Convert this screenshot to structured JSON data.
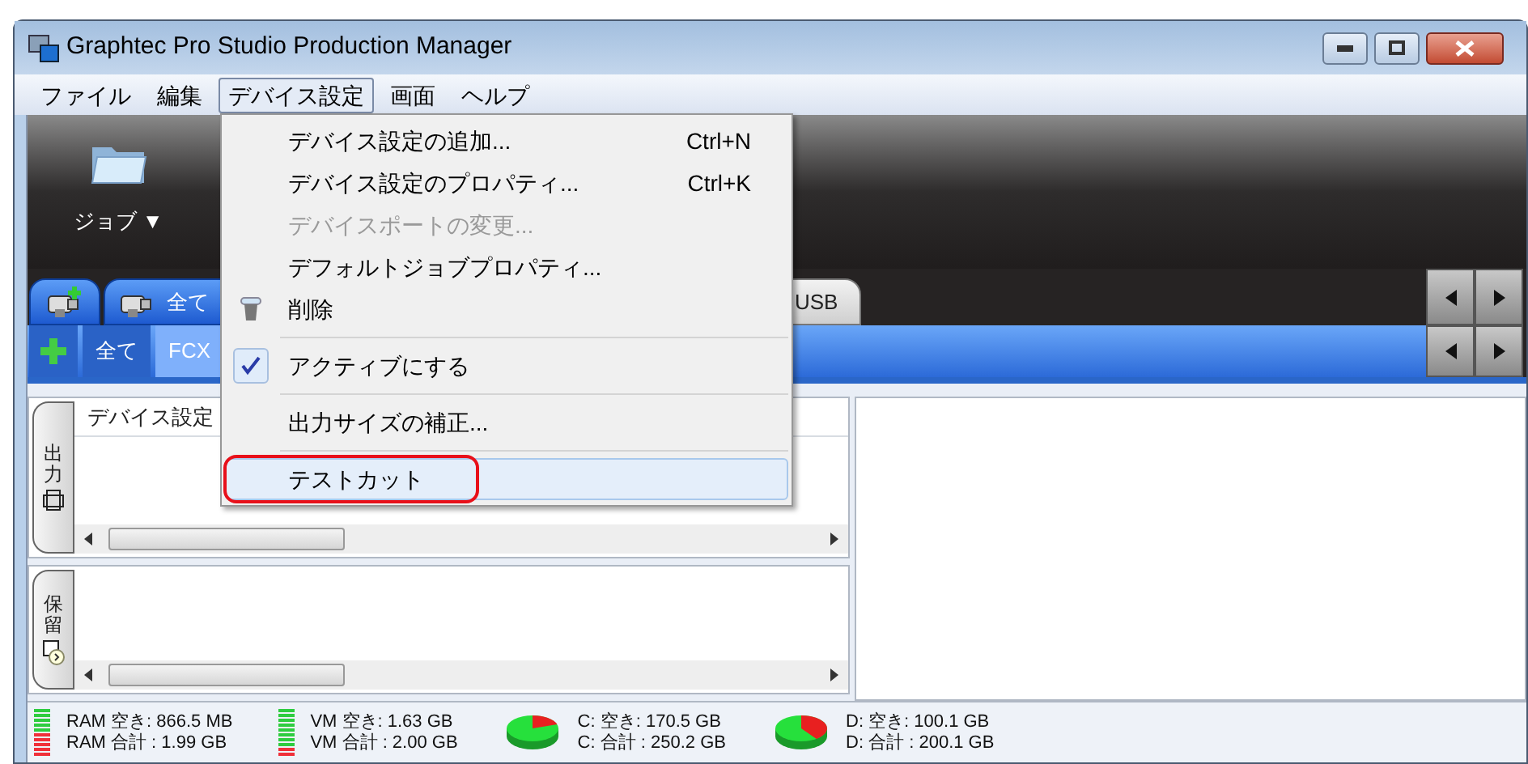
{
  "window": {
    "title": "Graphtec Pro Studio Production Manager"
  },
  "menu_bar": [
    {
      "label": "ファイル",
      "selected": false
    },
    {
      "label": "編集",
      "selected": false
    },
    {
      "label": "デバイス設定",
      "selected": true
    },
    {
      "label": "画面",
      "selected": false
    },
    {
      "label": "ヘルプ",
      "selected": false
    }
  ],
  "toolbar": {
    "job_button": "ジョブ ▼"
  },
  "device_tabs": [
    {
      "kind": "add",
      "selected": false
    },
    {
      "kind": "group",
      "label": "全て",
      "selected": false
    },
    {
      "kind": "device",
      "label": "USB",
      "selected": false
    }
  ],
  "filter_tabs": [
    {
      "kind": "add",
      "selected": false
    },
    {
      "kind": "text",
      "label": "全て",
      "selected": false
    },
    {
      "kind": "text",
      "label": "FCX",
      "selected": true
    }
  ],
  "output_panel": {
    "tab": "出力",
    "column_header": "デバイス設定"
  },
  "hold_panel": {
    "tab": "保留"
  },
  "dropdown": [
    {
      "kind": "item",
      "label": "デバイス設定の追加...",
      "shortcut": "Ctrl+N",
      "disabled": false,
      "checked": false,
      "highlighted": false,
      "circled": false
    },
    {
      "kind": "item",
      "label": "デバイス設定のプロパティ...",
      "shortcut": "Ctrl+K",
      "disabled": false,
      "checked": false,
      "highlighted": false,
      "circled": false
    },
    {
      "kind": "item",
      "label": "デバイスポートの変更...",
      "disabled": true,
      "checked": false,
      "highlighted": false,
      "circled": false
    },
    {
      "kind": "item",
      "label": "デフォルトジョブプロパティ...",
      "disabled": false,
      "checked": false,
      "highlighted": false,
      "circled": false
    },
    {
      "kind": "delete",
      "label": "削除",
      "disabled": false,
      "checked": false,
      "highlighted": false,
      "circled": false
    },
    {
      "kind": "separator"
    },
    {
      "kind": "item",
      "label": "アクティブにする",
      "disabled": false,
      "checked": true,
      "highlighted": false,
      "circled": false
    },
    {
      "kind": "separator"
    },
    {
      "kind": "item",
      "label": "出力サイズの補正...",
      "disabled": false,
      "checked": false,
      "highlighted": false,
      "circled": false
    },
    {
      "kind": "separator"
    },
    {
      "kind": "item",
      "label": "テストカット",
      "disabled": false,
      "checked": false,
      "highlighted": true,
      "circled": true
    }
  ],
  "status_bar": [
    {
      "kind": "bars",
      "free": "RAM 空き: 866.5 MB",
      "total": "RAM 合計 : 1.99 GB"
    },
    {
      "kind": "bars",
      "free": "VM 空き: 1.63 GB",
      "total": "VM 合計 : 2.00 GB"
    },
    {
      "kind": "pie",
      "free": "C: 空き: 170.5 GB",
      "total": "C: 合計 : 250.2 GB"
    },
    {
      "kind": "pie",
      "free": "D: 空き: 100.1 GB",
      "total": "D: 合計 : 200.1 GB"
    }
  ]
}
